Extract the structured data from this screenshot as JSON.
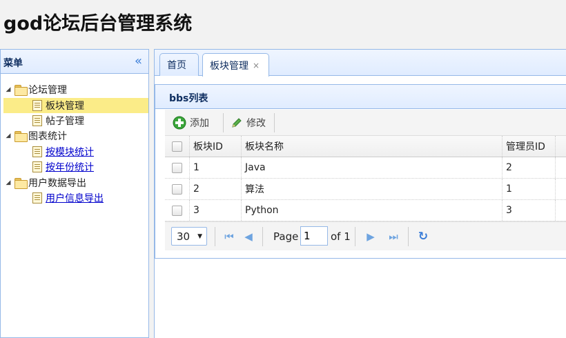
{
  "header": {
    "title": "god论坛后台管理系统"
  },
  "menu": {
    "title": "菜单",
    "collapse_icon": "double-chevron-left-icon",
    "tree": {
      "forum_mgmt": "论坛管理",
      "board_mgmt": "板块管理",
      "post_mgmt": "帖子管理",
      "chart_stats": "图表统计",
      "by_module": "按模块统计",
      "by_year": "按年份统计",
      "user_export": "用户数据导出",
      "user_info_export": "用户信息导出"
    }
  },
  "tabs": [
    {
      "label": "首页"
    },
    {
      "label": "板块管理",
      "close": "×"
    }
  ],
  "panel": {
    "title": "bbs列表",
    "toolbar": {
      "add": "添加",
      "edit": "修改"
    }
  },
  "grid": {
    "headers": [
      "板块ID",
      "板块名称",
      "管理员ID"
    ],
    "rows": [
      {
        "id": "1",
        "name": "Java",
        "admin": "2"
      },
      {
        "id": "2",
        "name": "算法",
        "admin": "1"
      },
      {
        "id": "3",
        "name": "Python",
        "admin": "3"
      }
    ]
  },
  "pager": {
    "page_size": "30",
    "page_label": "Page",
    "page_value": "1",
    "of_label": "of 1"
  },
  "colors": {
    "border": "#95b8e7",
    "selected": "#fbec88",
    "accent": "#3a7dd8"
  }
}
